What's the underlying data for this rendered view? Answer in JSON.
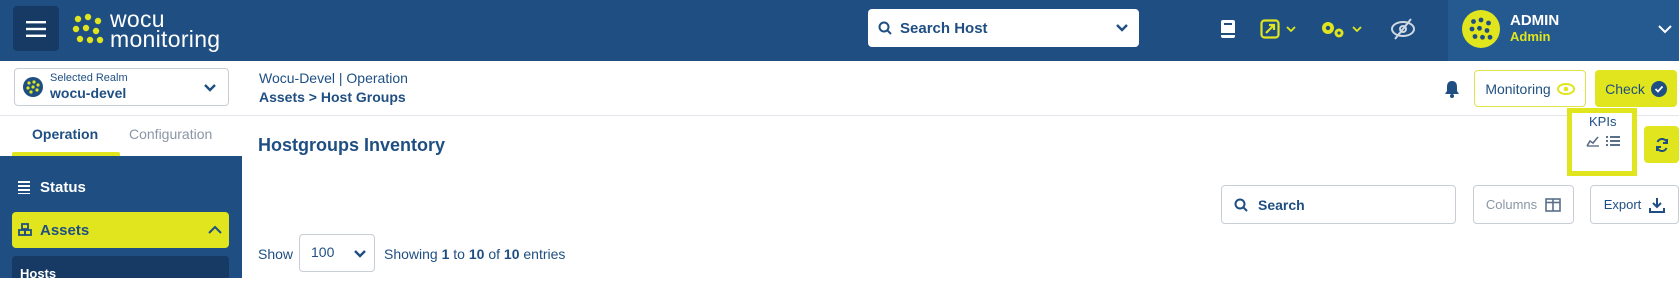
{
  "colors": {
    "navy": "#1f4f82",
    "accent": "#e0e51e",
    "dark": "#163a63"
  },
  "header": {
    "logo_line1": "wocu",
    "logo_line2": "monitoring",
    "host_search_label": "Search Host",
    "icons": [
      "book-icon",
      "external-link-icon",
      "gears-icon",
      "eye-slash-icon"
    ],
    "user": {
      "name": "ADMIN",
      "role": "Admin"
    }
  },
  "realm": {
    "label": "Selected Realm",
    "value": "wocu-devel"
  },
  "breadcrumb": {
    "line1": "Wocu-Devel | Operation",
    "line2": "Assets > Host Groups"
  },
  "actions": {
    "monitoring_label": "Monitoring",
    "check_label": "Check"
  },
  "sidebar": {
    "tabs": [
      {
        "label": "Operation",
        "active": true
      },
      {
        "label": "Configuration",
        "active": false
      }
    ],
    "items": [
      {
        "label": "Status"
      },
      {
        "label": "Assets",
        "expanded": true
      }
    ],
    "subitems": [
      {
        "label": "Hosts"
      }
    ]
  },
  "main": {
    "title": "Hostgroups Inventory",
    "kpis_label": "KPIs",
    "search_placeholder": "Search",
    "columns_label": "Columns",
    "export_label": "Export",
    "show_label": "Show",
    "page_size": "100",
    "entries_prefix": "Showing",
    "entries_from": "1",
    "entries_to_word": "to",
    "entries_to": "10",
    "entries_of_word": "of",
    "entries_total": "10",
    "entries_suffix": "entries"
  }
}
